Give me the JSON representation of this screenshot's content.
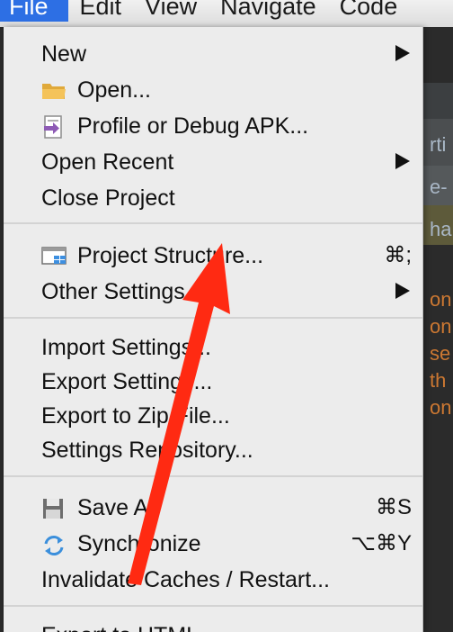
{
  "menubar": {
    "items": [
      "File",
      "Edit",
      "View",
      "Navigate",
      "Code"
    ]
  },
  "background_fragments": [
    "rti",
    "e-",
    "ha",
    "on",
    "on",
    "se",
    "th",
    "on"
  ],
  "menu": {
    "new": {
      "label": "New"
    },
    "open": {
      "label": "Open...",
      "icon": "folder-icon"
    },
    "profile": {
      "label": "Profile or Debug APK...",
      "icon": "apk-debug-icon"
    },
    "open_recent": {
      "label": "Open Recent"
    },
    "close_project": {
      "label": "Close Project"
    },
    "project_structure": {
      "label": "Project Structure...",
      "shortcut": "⌘;",
      "icon": "project-structure-icon"
    },
    "other_settings": {
      "label": "Other Settings"
    },
    "import_settings": {
      "label": "Import Settings..."
    },
    "export_settings": {
      "label": "Export Settings..."
    },
    "export_zip": {
      "label": "Export to Zip File..."
    },
    "settings_repo": {
      "label": "Settings Repository..."
    },
    "save_all": {
      "label": "Save All",
      "shortcut": "⌘S",
      "icon": "save-icon"
    },
    "synchronize": {
      "label": "Synchronize",
      "shortcut": "⌥⌘Y",
      "icon": "sync-icon"
    },
    "invalidate": {
      "label": "Invalidate Caches / Restart..."
    },
    "export_html": {
      "label": "Export to HTML..."
    }
  },
  "colors": {
    "menu_bg": "#ececec",
    "active_menu": "#2d6fe4",
    "annotation_arrow": "#ff2a12"
  }
}
